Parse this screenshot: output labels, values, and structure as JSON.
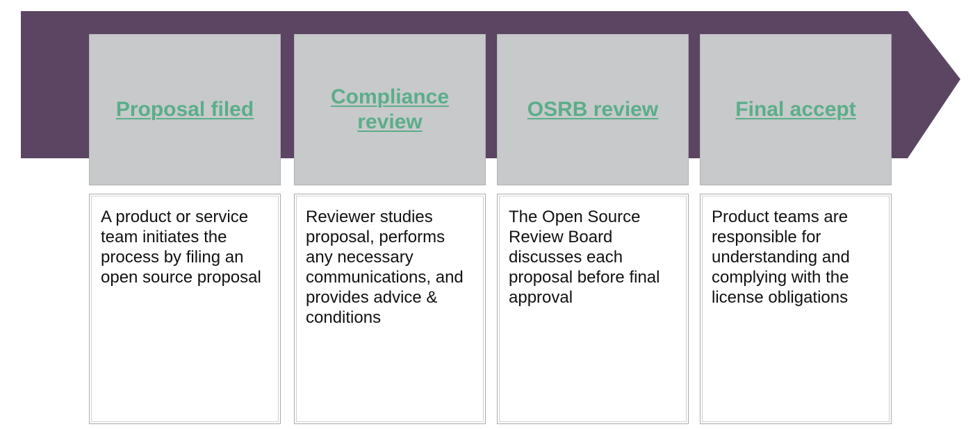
{
  "colors": {
    "band": "#5b4562",
    "header_bg": "#c8c9cb",
    "title": "#5aae89",
    "text": "#111111"
  },
  "stages": [
    {
      "title": "Proposal filed",
      "description": "A product or service team initiates the process by filing an open source proposal"
    },
    {
      "title": "Compliance review",
      "description": "Reviewer studies proposal, performs any necessary communications, and provides advice & conditions"
    },
    {
      "title": "OSRB review",
      "description": "The Open Source Review Board discusses each proposal before final approval"
    },
    {
      "title": "Final accept",
      "description": "Product teams are responsible for understanding and complying with the license obligations"
    }
  ]
}
